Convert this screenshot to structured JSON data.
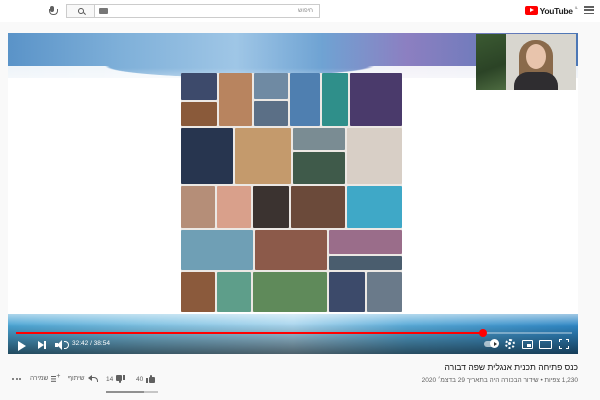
{
  "header": {
    "logo_text": "YouTube",
    "logo_region": "IL",
    "search_placeholder": "חיפוש"
  },
  "player": {
    "current_time": "32:42",
    "duration": "38:54",
    "progress_fraction": 0.84,
    "time_display": "32:42 / 38:54"
  },
  "video": {
    "title": "כנס פתיחה תכנית אנגלית שפה דבורה",
    "meta": "1,230 צפיות • שידור הבכורה היה בתאריך 29 בדצמ׳ 2020"
  },
  "actions": {
    "like_count": "40",
    "dislike_count": "14",
    "share_label": "שיתוף",
    "save_label": "שמירה",
    "like_fraction": 0.74
  },
  "colors": {
    "accent": "#ff0000",
    "text_primary": "#030303",
    "text_secondary": "#606060"
  }
}
